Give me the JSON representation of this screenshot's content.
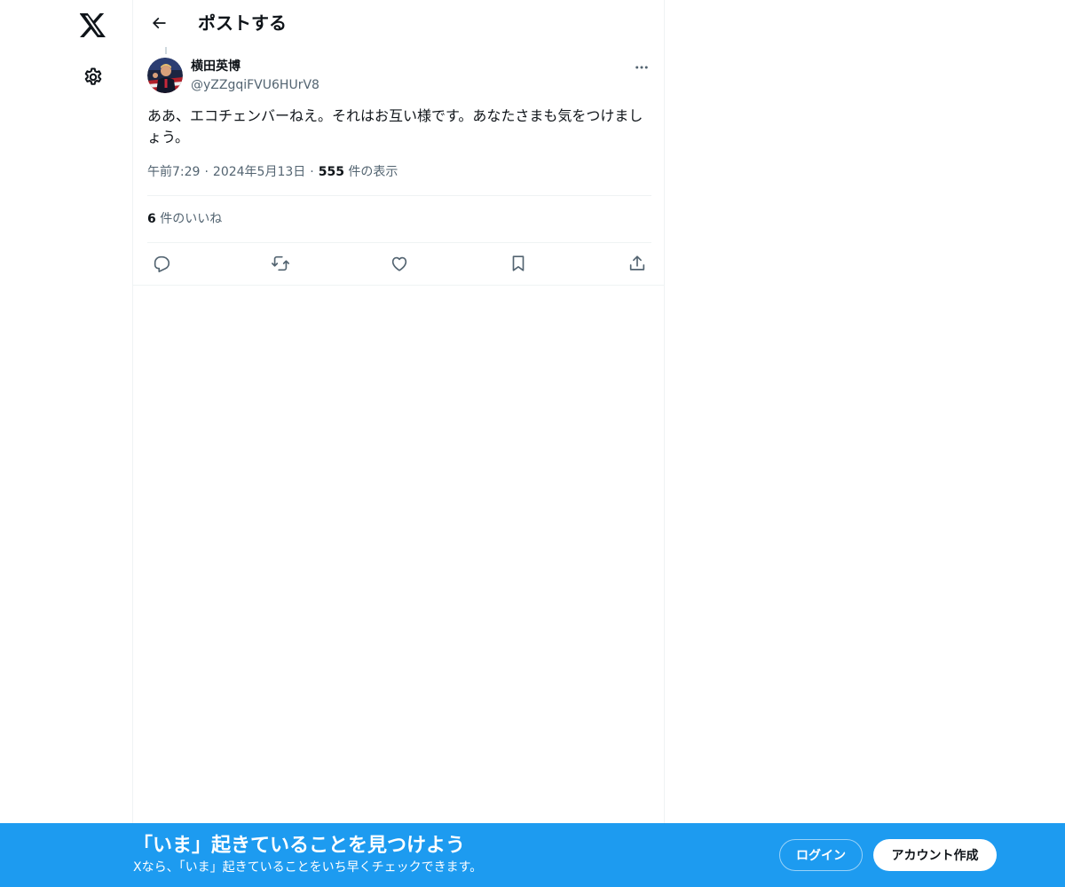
{
  "header": {
    "title": "ポストする"
  },
  "nav": {
    "logo_icon": "x-logo-icon",
    "settings_icon": "gear-icon",
    "back_icon": "arrow-left-icon"
  },
  "tweet": {
    "author_name": "横田英博",
    "author_handle": "@yZZgqiFVU6HUrV8",
    "text": "ああ、エコチェンバーねえ。それはお互い様です。あなたさまも気をつけましょう。",
    "time": "午前7:29",
    "separator": "·",
    "date": "2024年5月13日",
    "views_count": "555",
    "views_label": "件の表示",
    "likes_count": "6",
    "likes_label": "件のいいね"
  },
  "actions": {
    "icons": [
      "reply-icon",
      "retweet-icon",
      "like-icon",
      "bookmark-icon",
      "share-icon"
    ]
  },
  "banner": {
    "title": "「いま」起きていることを見つけよう",
    "subtitle": "Xなら、「いま」起きていることをいち早くチェックできます。",
    "login_label": "ログイン",
    "signup_label": "アカウント作成"
  },
  "colors": {
    "accent": "#1d9bf0",
    "text_primary": "#0f1419",
    "text_secondary": "#536471",
    "border": "#eff3f4"
  }
}
